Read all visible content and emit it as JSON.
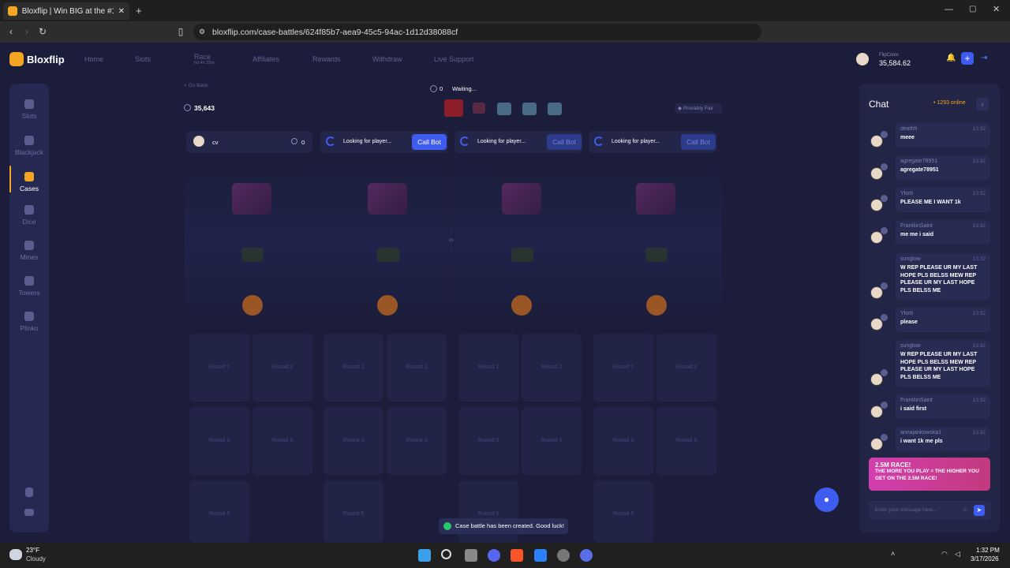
{
  "browser": {
    "tab_title": "Bloxflip | Win BIG at the #1 gam",
    "url": "bloxflip.com/case-battles/624f85b7-aea9-45c5-94ac-1d12d38088cf"
  },
  "site": {
    "logo": "Bloxflip",
    "nav": [
      "Home",
      "Slots",
      "Race",
      "Affiliates",
      "Rewards",
      "Withdraw",
      "Live Support"
    ],
    "race_sub": "6d 4h 28m",
    "currency_label": "FlipCoins",
    "balance": "35,584.62"
  },
  "sidebar": {
    "items": [
      "Slots",
      "Blackjack",
      "Cases",
      "Dice",
      "Mines",
      "Towers",
      "Plinko"
    ]
  },
  "battle": {
    "back": "< Go Back",
    "player_count": "0",
    "status": "Waiting...",
    "total": "35,643",
    "provably_fair": "Provably Fair",
    "player_name": "cv",
    "player_value": "0",
    "looking": "Looking for player...",
    "call_bot": "Call Bot",
    "vs": "vs",
    "rounds": [
      "Round 1",
      "Round 2",
      "Round 3",
      "Round 4",
      "Round 5"
    ]
  },
  "chat": {
    "title": "Chat",
    "online": "1293 online",
    "messages": [
      {
        "user": "deathh",
        "time": "13:32",
        "text": "meee"
      },
      {
        "user": "agregate78951",
        "time": "13:32",
        "text": "agregate78951"
      },
      {
        "user": "Ylorti",
        "time": "13:32",
        "text": "PLEASE ME I WANT 1k"
      },
      {
        "user": "FranklinSaint",
        "time": "13:32",
        "text": "me me i said"
      },
      {
        "user": "sunglow",
        "time": "13:32",
        "text": "W REP PLEASE UR MY LAST HOPE PLS BELSS MEW REP PLEASE UR MY LAST HOPE PLS BELSS ME"
      },
      {
        "user": "Ylorti",
        "time": "13:32",
        "text": "please"
      },
      {
        "user": "sunglow",
        "time": "13:32",
        "text": "W REP PLEASE UR MY LAST HOPE PLS BELSS MEW REP PLEASE UR MY LAST HOPE PLS BELSS ME"
      },
      {
        "user": "FranklinSaint",
        "time": "13:32",
        "text": "i said first"
      },
      {
        "user": "annajankowska1",
        "time": "13:32",
        "text": "i want 1k me pls"
      }
    ],
    "promo_title": "2.5M RACE!",
    "promo_text": "THE MORE YOU PLAY = THE HIGHER YOU GET ON THE 2.5M RACE!",
    "input_placeholder": "Enter your message here..."
  },
  "toast": "Case battle has been created. Good luck!",
  "taskbar": {
    "weather_temp": "23°F",
    "weather_desc": "Cloudy",
    "time": "1:32 PM",
    "date": "3/17/2026"
  }
}
